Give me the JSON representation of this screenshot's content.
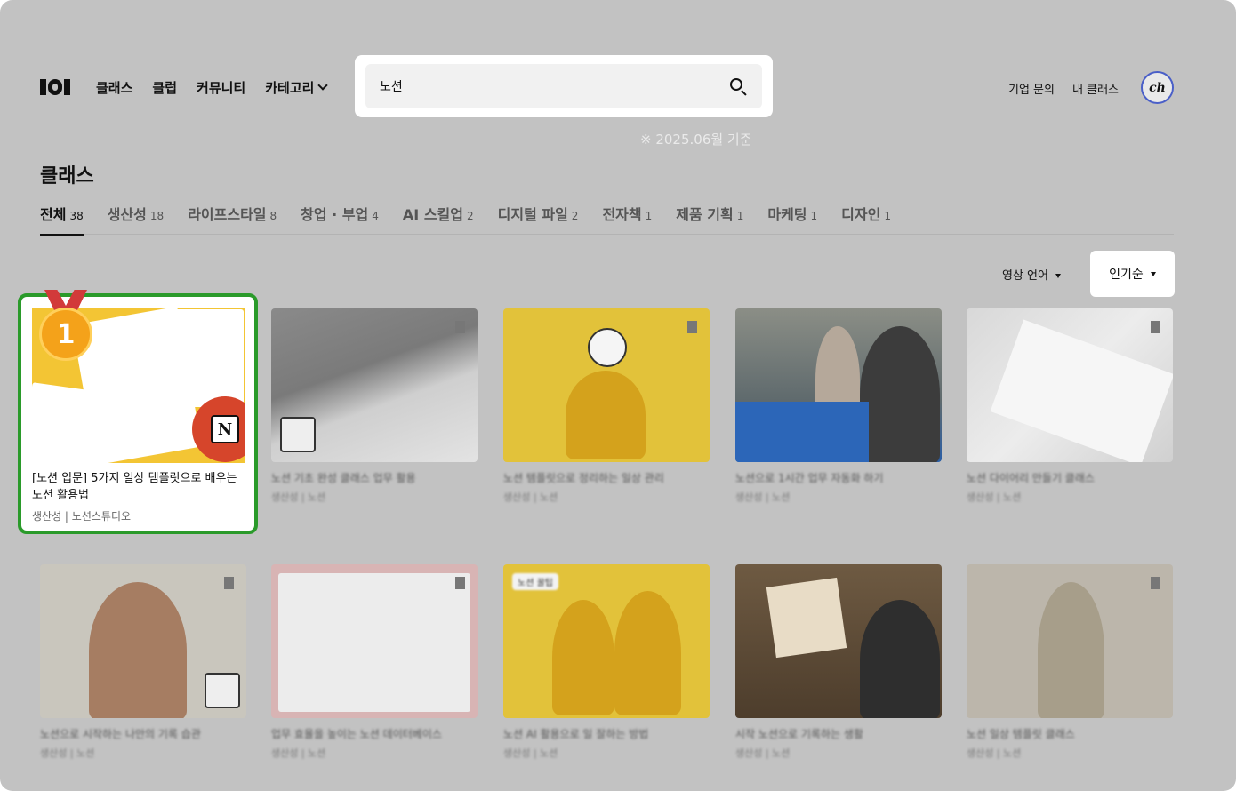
{
  "header": {
    "nav": [
      {
        "label": "클래스"
      },
      {
        "label": "클럽"
      },
      {
        "label": "커뮤니티"
      },
      {
        "label": "카테고리"
      }
    ],
    "search": {
      "value": "노션"
    },
    "note": "※ 2025.06월 기준",
    "right_nav": [
      "기업 문의",
      "내 클래스"
    ],
    "avatar_text": "ch"
  },
  "section": {
    "title": "클래스"
  },
  "tabs": [
    {
      "label": "전체",
      "count": "38",
      "active": true
    },
    {
      "label": "생산성",
      "count": "18"
    },
    {
      "label": "라이프스타일",
      "count": "8"
    },
    {
      "label": "창업 · 부업",
      "count": "4"
    },
    {
      "label": "AI 스킬업",
      "count": "2"
    },
    {
      "label": "디지털 파일",
      "count": "2"
    },
    {
      "label": "전자책",
      "count": "1"
    },
    {
      "label": "제품 기획",
      "count": "1"
    },
    {
      "label": "마케팅",
      "count": "1"
    },
    {
      "label": "디자인",
      "count": "1"
    }
  ],
  "filters": {
    "language": "영상 언어",
    "sort": "인기순"
  },
  "featured": {
    "rank": "1",
    "title": "[노션 입문] 5가지 일상 템플릿으로 배우는 노션 활용법",
    "meta": "생산성 | 노션스튜디오"
  },
  "cards": [
    {
      "title": "노션 기초 완성 클래스 업무 활용",
      "meta": "생산성 | 노션"
    },
    {
      "title": "노션 템플릿으로 정리하는 일상 관리",
      "meta": "생산성 | 노션"
    },
    {
      "title": "노션으로 1시간 업무 자동화 하기",
      "meta": "생산성 | 노션"
    },
    {
      "title": "노션 다이어리 만들기 클래스",
      "meta": "생산성 | 노션"
    },
    {
      "title": "노션으로 시작하는 나만의 기록 습관",
      "meta": "생산성 | 노션"
    },
    {
      "title": "업무 효율을 높이는 노션 데이터베이스",
      "meta": "생산성 | 노션"
    },
    {
      "title": "노션 AI 활용으로 일 잘하는 방법",
      "meta": "생산성 | 노션"
    },
    {
      "title": "시작 노션으로 기록하는 생활",
      "meta": "생산성 | 노션"
    },
    {
      "title": "노션 일상 템플릿 클래스",
      "meta": "생산성 | 노션"
    }
  ],
  "card_tag": "노션 꿀팁",
  "colors": {
    "accent_green": "#2a9a2a",
    "avatar_ring": "#4a5fc8",
    "brand_yellow": "#f3c534"
  }
}
